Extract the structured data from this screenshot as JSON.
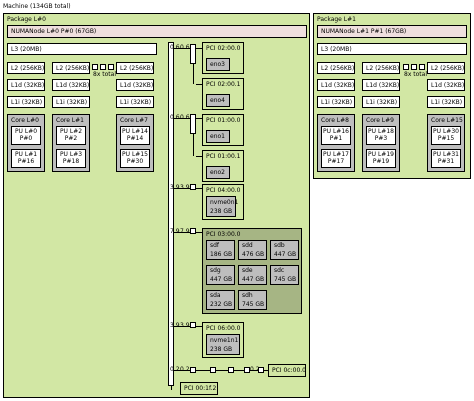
{
  "machine": {
    "title": "Machine (134GB total)"
  },
  "package0": {
    "title": "Package L#0",
    "numa": "NUMANode L#0 P#0 (67GB)",
    "l3": "L3 (20MB)",
    "l2": "L2 (256KB)",
    "l1d": "L1d (32KB)",
    "l1i": "L1i (32KB)",
    "more": "8x total",
    "cores": [
      {
        "label": "Core L#0",
        "pu": [
          "PU L#0\nP#0",
          "PU L#1\nP#16"
        ]
      },
      {
        "label": "Core L#1",
        "pu": [
          "PU L#2\nP#2",
          "PU L#3\nP#18"
        ]
      },
      {
        "label": "Core L#7",
        "pu": [
          "PU L#14\nP#14",
          "PU L#15\nP#30"
        ]
      }
    ]
  },
  "package1": {
    "title": "Package L#1",
    "numa": "NUMANode L#1 P#1 (67GB)",
    "l3": "L3 (20MB)",
    "l2": "L2 (256KB)",
    "l1d": "L1d (32KB)",
    "l1i": "L1i (32KB)",
    "more": "8x total",
    "cores": [
      {
        "label": "Core L#8",
        "pu": [
          "PU L#16\nP#1",
          "PU L#17\nP#17"
        ]
      },
      {
        "label": "Core L#9",
        "pu": [
          "PU L#18\nP#3",
          "PU L#19\nP#19"
        ]
      },
      {
        "label": "Core L#15",
        "pu": [
          "PU L#30\nP#15",
          "PU L#31\nP#31"
        ]
      }
    ]
  },
  "pci": {
    "links": {
      "l1": "0.6",
      "l2": "0.6",
      "l3": "0.6",
      "l4": "0.6",
      "l5": "3.9",
      "l6": "3.9",
      "l7": "7.9",
      "l8": "7.9",
      "l9": "3.9",
      "l10": "3.9",
      "l11": "0.2",
      "l12": "0.2",
      "l13": "0.2"
    },
    "dev_0200_0": {
      "title": "PCI 02:00.0",
      "os": "eno3"
    },
    "dev_0200_1": {
      "title": "PCI 02:00.1",
      "os": "eno4"
    },
    "dev_0100_0": {
      "title": "PCI 01:00.0",
      "os": "eno1"
    },
    "dev_0100_1": {
      "title": "PCI 01:00.1",
      "os": "eno2"
    },
    "dev_0400_0": {
      "title": "PCI 04:00.0",
      "os": "nvme0n1",
      "size": "238 GB"
    },
    "dev_0300_0": {
      "title": "PCI 03:00.0",
      "disks": [
        {
          "name": "sdf",
          "size": "186 GB"
        },
        {
          "name": "sdd",
          "size": "476 GB"
        },
        {
          "name": "sdb",
          "size": "447 GB"
        },
        {
          "name": "sdg",
          "size": "447 GB"
        },
        {
          "name": "sde",
          "size": "447 GB"
        },
        {
          "name": "sdc",
          "size": "745 GB"
        },
        {
          "name": "sda",
          "size": "232 GB"
        },
        {
          "name": "sdh",
          "size": "745 GB"
        }
      ]
    },
    "dev_0600_0": {
      "title": "PCI 06:00.0",
      "os": "nvme1n1",
      "size": "238 GB"
    },
    "dev_001f_2": {
      "title": "PCI 00:1f.2"
    },
    "dev_000c_0": {
      "title": "PCI 0c:00.0"
    }
  }
}
